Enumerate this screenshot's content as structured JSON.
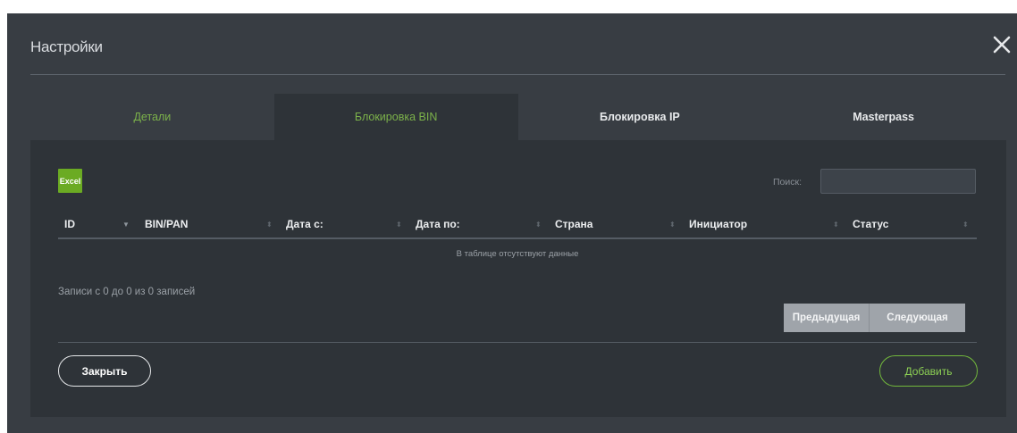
{
  "modal": {
    "title": "Настройки"
  },
  "tabs": [
    {
      "label": "Детали",
      "active": false
    },
    {
      "label": "Блокировка BIN",
      "active": true
    },
    {
      "label": "Блокировка IP",
      "active": false
    },
    {
      "label": "Masterpass",
      "active": false
    }
  ],
  "toolbar": {
    "excel_label": "Excel",
    "search_label": "Поиск:",
    "search_value": ""
  },
  "table": {
    "columns": [
      "ID",
      "BIN/PAN",
      "Дата с:",
      "Дата по:",
      "Страна",
      "Инициатор",
      "Статус"
    ],
    "empty_message": "В таблице отсутствуют данные",
    "info": "Записи с 0 до 0 из 0 записей"
  },
  "pagination": {
    "prev_label": "Предыдущая",
    "next_label": "Следующая"
  },
  "footer": {
    "close_label": "Закрыть",
    "add_label": "Добавить"
  },
  "colors": {
    "accent_green": "#6bab23",
    "modal_bg": "#383d43",
    "panel_bg": "#2e3338"
  }
}
